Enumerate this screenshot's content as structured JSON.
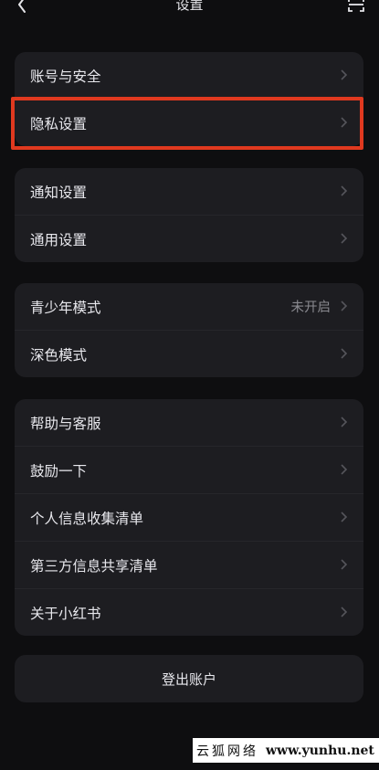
{
  "header": {
    "title": "设置"
  },
  "groups": [
    {
      "items": [
        {
          "label": "账号与安全"
        },
        {
          "label": "隐私设置"
        }
      ]
    },
    {
      "items": [
        {
          "label": "通知设置"
        },
        {
          "label": "通用设置"
        }
      ]
    },
    {
      "items": [
        {
          "label": "青少年模式",
          "value": "未开启"
        },
        {
          "label": "深色模式"
        }
      ]
    },
    {
      "items": [
        {
          "label": "帮助与客服"
        },
        {
          "label": "鼓励一下"
        },
        {
          "label": "个人信息收集清单"
        },
        {
          "label": "第三方信息共享清单"
        },
        {
          "label": "关于小红书"
        }
      ]
    }
  ],
  "logout_label": "登出账户",
  "watermark": {
    "name": "云狐网络",
    "url": "www.yunhu.net"
  },
  "colors": {
    "background": "#0e0e10",
    "card": "#1d1d21",
    "highlight": "#e0391f"
  },
  "icons": {
    "back": "chevron-left-icon",
    "scan": "scan-icon",
    "row": "chevron-right-icon"
  }
}
